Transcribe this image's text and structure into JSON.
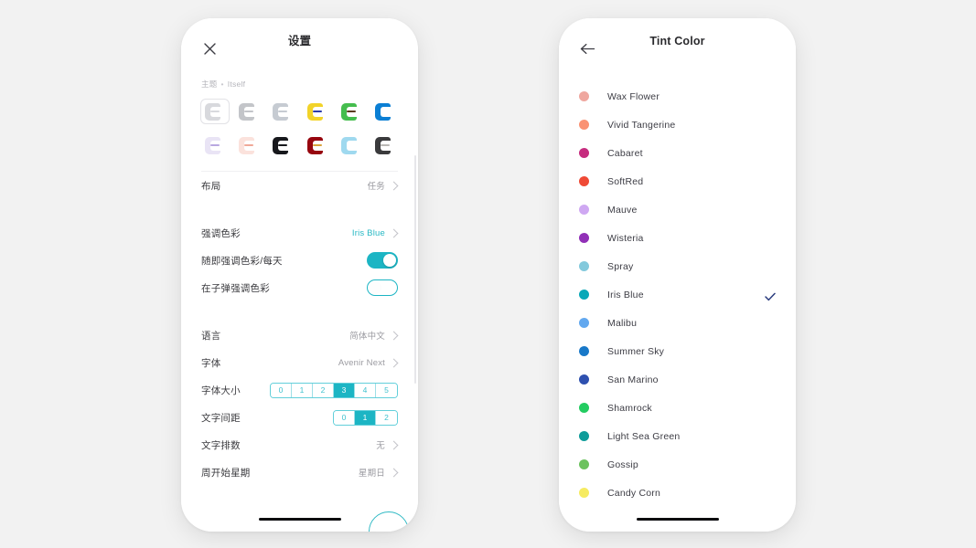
{
  "canvas": {
    "background": "#f2f2f2"
  },
  "left_phone": {
    "navbar": {
      "close_icon": "close-icon",
      "title": "设置"
    },
    "theme_section": {
      "label_primary": "主题",
      "separator": "•",
      "label_secondary": "Itself",
      "swatches": [
        {
          "name": "itself-light",
          "body": "#d8d9dd",
          "bar": "#d8d9dd",
          "selected": true
        },
        {
          "name": "grey-soft",
          "body": "#c3c5c9",
          "bar": "#c3c5c9",
          "selected": false
        },
        {
          "name": "grey-blue",
          "body": "#c6cbd2",
          "bar": "#c6cbd2",
          "selected": false
        },
        {
          "name": "yellow",
          "body": "#f2d329",
          "bar": "#2b3ba8",
          "selected": false
        },
        {
          "name": "green",
          "body": "#45bd4e",
          "bar": "#5b3a1f",
          "selected": false
        },
        {
          "name": "blue",
          "body": "#0b7fd4",
          "bar": "#ffffff",
          "selected": false
        },
        {
          "name": "lavender",
          "body": "#e9e4f5",
          "bar": "#b9a8e0",
          "selected": false
        },
        {
          "name": "peach",
          "body": "#fbe2dc",
          "bar": "#f0a898",
          "selected": false
        },
        {
          "name": "black",
          "body": "#17181c",
          "bar": "#17181c",
          "selected": false
        },
        {
          "name": "dark-red",
          "body": "#97060f",
          "bar": "#d9a23c",
          "selected": false
        },
        {
          "name": "sky-pink",
          "body": "#9fd9ef",
          "bar": "#ffffff",
          "selected": false
        },
        {
          "name": "photo",
          "body": "#3a3a3c",
          "bar": "#b9b7b4",
          "selected": false
        }
      ]
    },
    "rows": [
      {
        "name": "layout",
        "title": "布局",
        "value": "任务",
        "type": "chevron",
        "accent": false
      },
      {
        "name": "accent-color",
        "title": "强调色彩",
        "value": "Iris Blue",
        "type": "chevron",
        "accent": true
      },
      {
        "name": "random-accent",
        "title": "随即强调色彩/每天",
        "value": "",
        "type": "toggle-on",
        "accent": false
      },
      {
        "name": "bullet-accent",
        "title": "在子弹强调色彩",
        "value": "",
        "type": "toggle-off",
        "accent": false
      },
      {
        "name": "language",
        "title": "语言",
        "value": "简体中文",
        "type": "chevron",
        "accent": false
      },
      {
        "name": "font",
        "title": "字体",
        "value": "Avenir Next",
        "type": "chevron",
        "accent": false
      },
      {
        "name": "font-size",
        "title": "字体大小",
        "value": "",
        "type": "segment-size",
        "accent": false
      },
      {
        "name": "letter-spacing",
        "title": "文字间距",
        "value": "",
        "type": "segment-spacing",
        "accent": false
      },
      {
        "name": "text-lines",
        "title": "文字排数",
        "value": "无",
        "type": "chevron",
        "accent": false
      },
      {
        "name": "week-start",
        "title": "周开始星期",
        "value": "星期日",
        "type": "chevron",
        "accent": false
      }
    ],
    "font_size_segment": {
      "options": [
        "0",
        "1",
        "2",
        "3",
        "4",
        "5"
      ],
      "selected": "3"
    },
    "letter_spacing_segment": {
      "options": [
        "0",
        "1",
        "2"
      ],
      "selected": "1"
    },
    "accent_hex": "#1cb5c4"
  },
  "right_phone": {
    "navbar": {
      "back_icon": "arrow-left-icon",
      "title": "Tint Color"
    },
    "selected": "Iris Blue",
    "check_color": "#2a3c7e",
    "colors": [
      {
        "name": "Wax Flower",
        "hex": "#efa79f",
        "checked": false
      },
      {
        "name": "Vivid Tangerine",
        "hex": "#fa9273",
        "checked": false
      },
      {
        "name": "Cabaret",
        "hex": "#c62c7f",
        "checked": false
      },
      {
        "name": "SoftRed",
        "hex": "#ef4a36",
        "checked": false
      },
      {
        "name": "Mauve",
        "hex": "#cfa8f2",
        "checked": false
      },
      {
        "name": "Wisteria",
        "hex": "#9130b7",
        "checked": false
      },
      {
        "name": "Spray",
        "hex": "#83c9dc",
        "checked": false
      },
      {
        "name": "Iris Blue",
        "hex": "#0aa8b8",
        "checked": true
      },
      {
        "name": "Malibu",
        "hex": "#62a8ef",
        "checked": false
      },
      {
        "name": "Summer Sky",
        "hex": "#1878c8",
        "checked": false
      },
      {
        "name": "San Marino",
        "hex": "#2e50af",
        "checked": false
      },
      {
        "name": "Shamrock",
        "hex": "#23cc61",
        "checked": false
      },
      {
        "name": "Light Sea Green",
        "hex": "#0f9c9a",
        "checked": false
      },
      {
        "name": "Gossip",
        "hex": "#6cc25e",
        "checked": false
      },
      {
        "name": "Candy Corn",
        "hex": "#f6eb61",
        "checked": false
      }
    ]
  }
}
